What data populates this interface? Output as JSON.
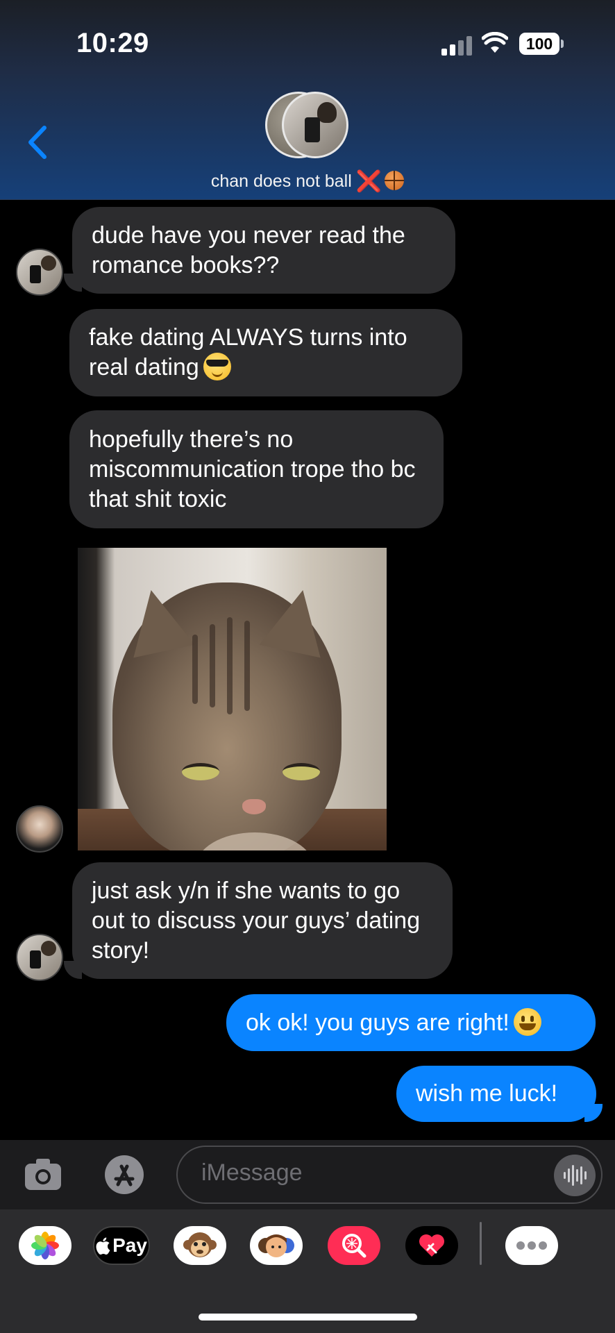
{
  "status_bar": {
    "time": "10:29",
    "battery": "100"
  },
  "header": {
    "chat_name": "chan does not ball",
    "name_suffix": "❌"
  },
  "messages": [
    {
      "from": "chan",
      "text": "dude have you never read the romance books??"
    },
    {
      "from": "chan",
      "text": "fake dating ALWAYS turns into real dating",
      "emoji": "smiling-face-with-sunglasses"
    },
    {
      "from": "chan",
      "text": "hopefully there’s no miscommunication trope tho bc that shit toxic"
    },
    {
      "from": "other",
      "type": "image",
      "alt": "cat-photo"
    },
    {
      "from": "chan",
      "text": "just ask y/n if she wants to go out to discuss your guys’ dating story!"
    },
    {
      "from": "me",
      "text": "ok ok! you guys are right!",
      "emoji": "grinning-face"
    },
    {
      "from": "me",
      "text": "wish me luck!"
    }
  ],
  "input": {
    "placeholder": "iMessage"
  },
  "app_drawer": {
    "apple_pay_label": "Pay",
    "apps": [
      "photos-icon",
      "apple-pay-icon",
      "animoji-monkey-icon",
      "memoji-icon",
      "image-search-icon",
      "digital-touch-icon",
      "more-icon"
    ]
  },
  "colors": {
    "sent_bubble": "#0a84ff",
    "received_bubble": "#2c2c2e",
    "background": "#000000"
  }
}
